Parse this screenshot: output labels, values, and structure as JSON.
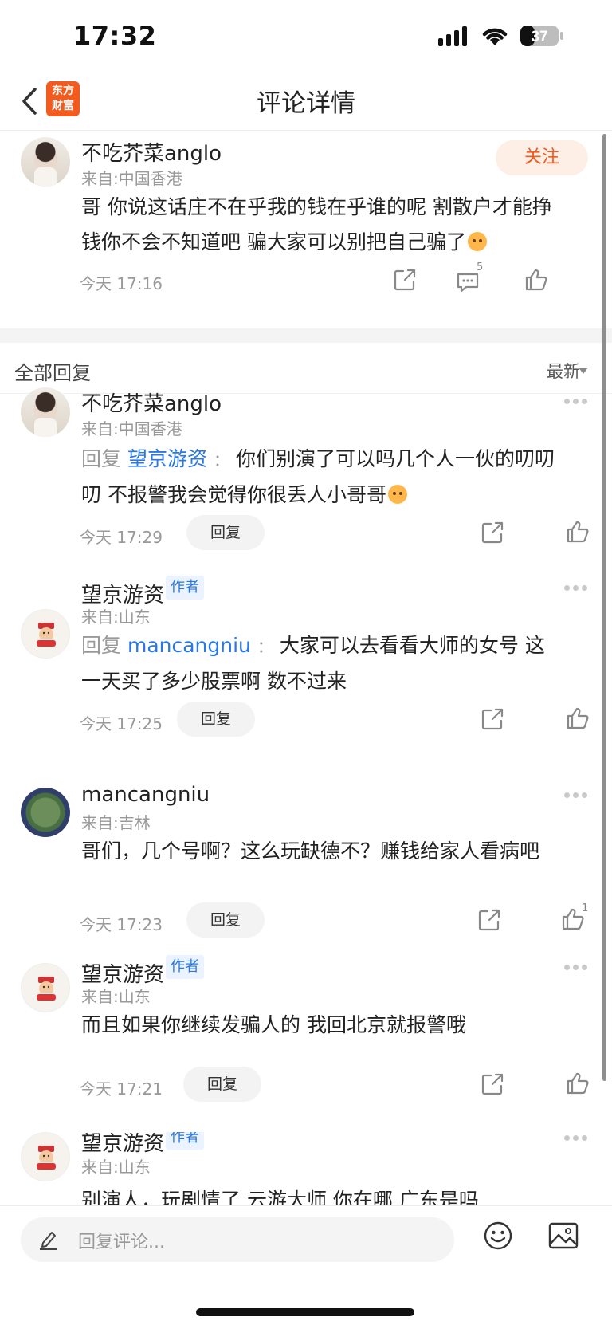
{
  "status_bar": {
    "time": "17:32",
    "battery": "37"
  },
  "nav": {
    "title": "评论详情",
    "logo_line1": "东方",
    "logo_line2": "财富"
  },
  "main_comment": {
    "username": "不吃芥菜anglo",
    "origin": "来自:中国香港",
    "follow_label": "关注",
    "text": "哥 你说这话庄不在乎我的钱在乎谁的呢 割散户才能挣钱你不会不知道吧 骗大家可以别把自己骗了",
    "time": "今天 17:16",
    "comment_count": "5"
  },
  "section": {
    "title": "全部回复",
    "sort_label": "最新"
  },
  "replies": [
    {
      "username": "不吃芥菜anglo",
      "origin": "来自:中国香港",
      "reply_prefix": "回复",
      "reply_to": "望京游资",
      "colon": "：",
      "text": "你们别演了可以吗几个人一伙的叨叨叨 不报警我会觉得你很丢人小哥哥",
      "time": "今天 17:29",
      "reply_btn": "回复"
    },
    {
      "username": "望京游资",
      "tag": "作者",
      "origin": "来自:山东",
      "reply_prefix": "回复",
      "reply_to": "mancangniu",
      "colon": "：",
      "text": "大家可以去看看大师的女号 这一天买了多少股票啊 数不过来",
      "time": "今天 17:25",
      "reply_btn": "回复"
    },
    {
      "username": "mancangniu",
      "origin": "来自:吉林",
      "text": "哥们，几个号啊？这么玩缺德不？赚钱给家人看病吧",
      "time": "今天 17:23",
      "reply_btn": "回复",
      "like_count": "1"
    },
    {
      "username": "望京游资",
      "tag": "作者",
      "origin": "来自:山东",
      "text": "而且如果你继续发骗人的 我回北京就报警哦",
      "time": "今天 17:21",
      "reply_btn": "回复"
    },
    {
      "username": "望京游资",
      "tag": "作者",
      "origin": "来自:山东",
      "text": "别演人，玩剧情了 云游大师 你在哪 广东是吗"
    }
  ],
  "bottom_bar": {
    "placeholder": "回复评论..."
  },
  "colors": {
    "accent": "#f25a1e",
    "link": "#2a78e4"
  },
  "icons": [
    "back-chevron-icon",
    "share-icon",
    "comment-icon",
    "like-icon",
    "more-icon",
    "pencil-icon",
    "emoji-icon",
    "image-icon"
  ]
}
